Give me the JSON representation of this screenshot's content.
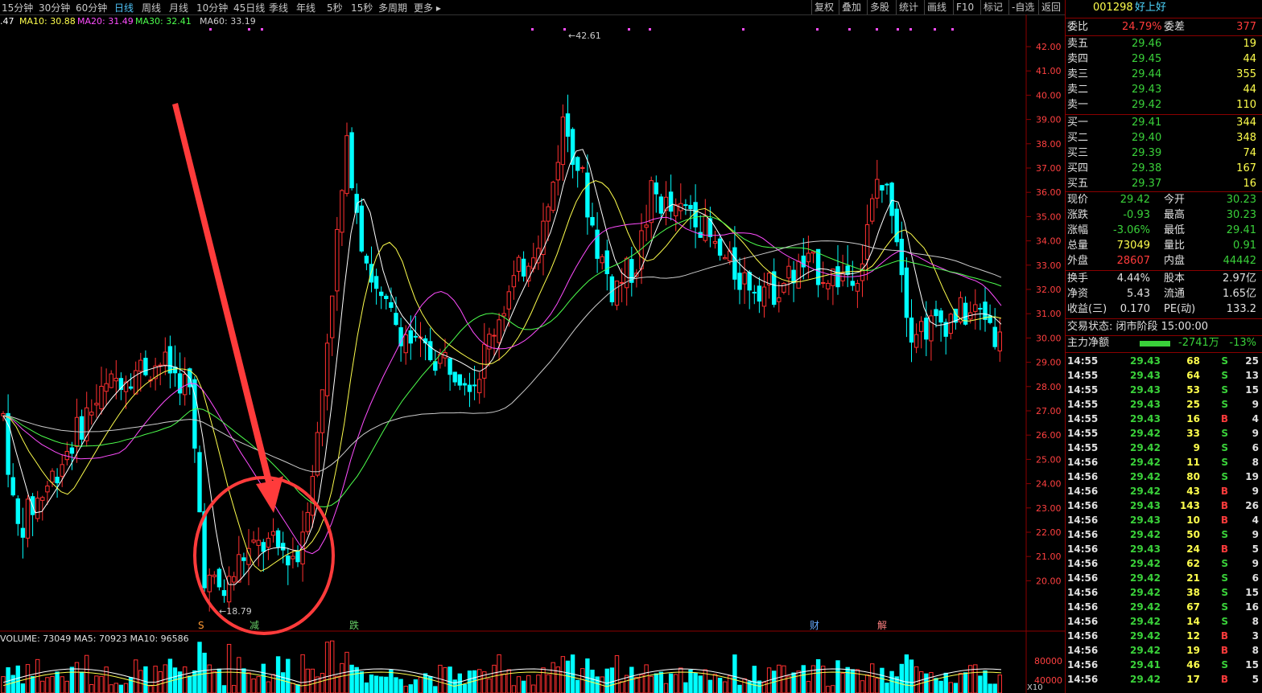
{
  "toolbar": {
    "periods": [
      "15分钟",
      "30分钟",
      "60分钟",
      "日线",
      "周线",
      "月线",
      "10分钟",
      "45日线",
      "季线",
      "年线",
      "5秒",
      "15秒",
      "多周期",
      "更多 ▸"
    ],
    "active_period": "日线",
    "tools": [
      "复权",
      "叠加",
      "多股",
      "统计",
      "画线",
      "F10",
      "标记",
      "-自选",
      "返回"
    ]
  },
  "ma_legend": [
    {
      "text": ".47",
      "color": "#ffffff"
    },
    {
      "text": "MA10: 30.88",
      "color": "#ffff4d"
    },
    {
      "text": "MA20: 31.49",
      "color": "#ff4dff"
    },
    {
      "text": "MA30: 32.41",
      "color": "#4dff4d"
    },
    {
      "text": "MA60: 33.19",
      "color": "#cccccc"
    }
  ],
  "volume_legend": "VOLUME: 73049  MA5: 70923  MA10: 96586",
  "chart_labels": {
    "high_marker": "42.61",
    "low_marker": "18.79",
    "event_s": "S",
    "event_jian": "减",
    "event_die": "跌",
    "event_cai": "财",
    "event_jie": "解",
    "vol_scale": "X10"
  },
  "price_axis": [
    "42.00",
    "41.00",
    "40.00",
    "39.00",
    "38.00",
    "37.00",
    "36.00",
    "35.00",
    "34.00",
    "33.00",
    "32.00",
    "31.00",
    "30.00",
    "29.00",
    "28.00",
    "27.00",
    "26.00",
    "25.00",
    "24.00",
    "23.00",
    "22.00",
    "21.00",
    "20.00"
  ],
  "volume_axis": [
    "80000",
    "40000"
  ],
  "stock": {
    "code": "001298",
    "name": "好上好"
  },
  "weibi": {
    "label": "委比",
    "value": "24.79%",
    "diff_label": "委差",
    "diff": "377"
  },
  "sell": [
    {
      "label": "卖五",
      "price": "29.46",
      "vol": "19"
    },
    {
      "label": "卖四",
      "price": "29.45",
      "vol": "44"
    },
    {
      "label": "卖三",
      "price": "29.44",
      "vol": "355"
    },
    {
      "label": "卖二",
      "price": "29.43",
      "vol": "44"
    },
    {
      "label": "卖一",
      "price": "29.42",
      "vol": "110"
    }
  ],
  "buy": [
    {
      "label": "买一",
      "price": "29.41",
      "vol": "344"
    },
    {
      "label": "买二",
      "price": "29.40",
      "vol": "348"
    },
    {
      "label": "买三",
      "price": "29.39",
      "vol": "74"
    },
    {
      "label": "买四",
      "price": "29.38",
      "vol": "167"
    },
    {
      "label": "买五",
      "price": "29.37",
      "vol": "16"
    }
  ],
  "quote": [
    {
      "l1": "现价",
      "v1": "29.42",
      "c1": "grn",
      "l2": "今开",
      "v2": "30.23",
      "c2": "grn"
    },
    {
      "l1": "涨跌",
      "v1": "-0.93",
      "c1": "grn",
      "l2": "最高",
      "v2": "30.23",
      "c2": "grn"
    },
    {
      "l1": "涨幅",
      "v1": "-3.06%",
      "c1": "grn",
      "l2": "最低",
      "v2": "29.41",
      "c2": "grn"
    },
    {
      "l1": "总量",
      "v1": "73049",
      "c1": "yel",
      "l2": "量比",
      "v2": "0.91",
      "c2": "grn"
    },
    {
      "l1": "外盘",
      "v1": "28607",
      "c1": "red",
      "l2": "内盘",
      "v2": "44442",
      "c2": "grn"
    }
  ],
  "fund": [
    {
      "l1": "换手",
      "v1": "4.44%",
      "l2": "股本",
      "v2": "2.97亿"
    },
    {
      "l1": "净资",
      "v1": "5.43",
      "l2": "流通",
      "v2": "1.65亿"
    },
    {
      "l1": "收益(三)",
      "v1": "0.170",
      "l2": "PE(动)",
      "v2": "133.2"
    }
  ],
  "trade_status": "交易状态: 闭市阶段 15:00:00",
  "main_flow": {
    "label": "主力净额",
    "value": "-2741万",
    "pct": "-13%"
  },
  "ticks": [
    {
      "t": "14:55",
      "p": "29.43",
      "v": "68",
      "d": "S",
      "n": "25"
    },
    {
      "t": "14:55",
      "p": "29.43",
      "v": "64",
      "d": "S",
      "n": "13"
    },
    {
      "t": "14:55",
      "p": "29.43",
      "v": "53",
      "d": "S",
      "n": "15"
    },
    {
      "t": "14:55",
      "p": "29.43",
      "v": "25",
      "d": "S",
      "n": "9"
    },
    {
      "t": "14:55",
      "p": "29.43",
      "v": "16",
      "d": "B",
      "n": "4"
    },
    {
      "t": "14:55",
      "p": "29.42",
      "v": "33",
      "d": "S",
      "n": "9"
    },
    {
      "t": "14:55",
      "p": "29.42",
      "v": "9",
      "d": "S",
      "n": "6"
    },
    {
      "t": "14:56",
      "p": "29.42",
      "v": "11",
      "d": "S",
      "n": "8"
    },
    {
      "t": "14:56",
      "p": "29.42",
      "v": "80",
      "d": "S",
      "n": "19"
    },
    {
      "t": "14:56",
      "p": "29.42",
      "v": "43",
      "d": "B",
      "n": "9"
    },
    {
      "t": "14:56",
      "p": "29.43",
      "v": "143",
      "d": "B",
      "n": "26"
    },
    {
      "t": "14:56",
      "p": "29.43",
      "v": "10",
      "d": "B",
      "n": "4"
    },
    {
      "t": "14:56",
      "p": "29.42",
      "v": "50",
      "d": "S",
      "n": "9"
    },
    {
      "t": "14:56",
      "p": "29.43",
      "v": "24",
      "d": "B",
      "n": "5"
    },
    {
      "t": "14:56",
      "p": "29.42",
      "v": "62",
      "d": "S",
      "n": "9"
    },
    {
      "t": "14:56",
      "p": "29.42",
      "v": "21",
      "d": "S",
      "n": "6"
    },
    {
      "t": "14:56",
      "p": "29.42",
      "v": "38",
      "d": "S",
      "n": "15"
    },
    {
      "t": "14:56",
      "p": "29.42",
      "v": "67",
      "d": "S",
      "n": "16"
    },
    {
      "t": "14:56",
      "p": "29.42",
      "v": "14",
      "d": "S",
      "n": "8"
    },
    {
      "t": "14:56",
      "p": "29.42",
      "v": "12",
      "d": "B",
      "n": "3"
    },
    {
      "t": "14:56",
      "p": "29.42",
      "v": "19",
      "d": "B",
      "n": "8"
    },
    {
      "t": "14:56",
      "p": "29.41",
      "v": "46",
      "d": "S",
      "n": "15"
    },
    {
      "t": "14:56",
      "p": "29.42",
      "v": "17",
      "d": "B",
      "n": "5"
    }
  ],
  "colors": {
    "up": "#ff3030",
    "down": "#00ffff",
    "ma5": "#ffffff",
    "ma10": "#ffff4d",
    "ma20": "#ff4dff",
    "ma30": "#4dff4d",
    "ma60": "#cccccc",
    "arrow": "#ff3b3b"
  }
}
